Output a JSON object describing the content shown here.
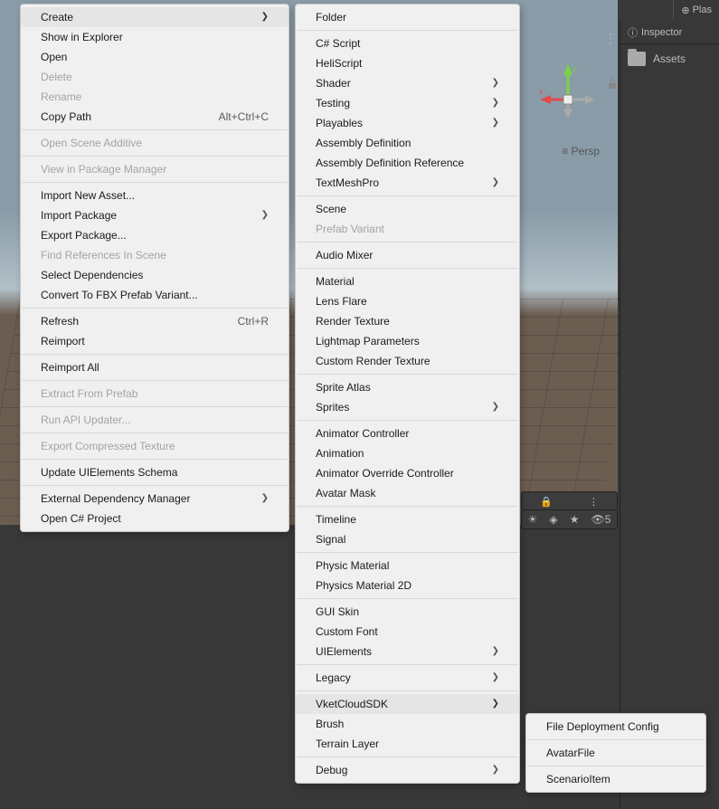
{
  "toolbar": {
    "plas": "Plas"
  },
  "scene": {
    "persp": "Persp",
    "visibility_count": "5"
  },
  "inspector": {
    "tab": "Inspector",
    "assets": "Assets"
  },
  "menu1": [
    {
      "label": "Create",
      "submenu": true,
      "hover": true
    },
    {
      "label": "Show in Explorer"
    },
    {
      "label": "Open"
    },
    {
      "label": "Delete",
      "disabled": true
    },
    {
      "label": "Rename",
      "disabled": true
    },
    {
      "label": "Copy Path",
      "shortcut": "Alt+Ctrl+C"
    },
    {
      "sep": true
    },
    {
      "label": "Open Scene Additive",
      "disabled": true
    },
    {
      "sep": true
    },
    {
      "label": "View in Package Manager",
      "disabled": true
    },
    {
      "sep": true
    },
    {
      "label": "Import New Asset..."
    },
    {
      "label": "Import Package",
      "submenu": true
    },
    {
      "label": "Export Package..."
    },
    {
      "label": "Find References In Scene",
      "disabled": true
    },
    {
      "label": "Select Dependencies"
    },
    {
      "label": "Convert To FBX Prefab Variant..."
    },
    {
      "sep": true
    },
    {
      "label": "Refresh",
      "shortcut": "Ctrl+R"
    },
    {
      "label": "Reimport"
    },
    {
      "sep": true
    },
    {
      "label": "Reimport All"
    },
    {
      "sep": true
    },
    {
      "label": "Extract From Prefab",
      "disabled": true
    },
    {
      "sep": true
    },
    {
      "label": "Run API Updater...",
      "disabled": true
    },
    {
      "sep": true
    },
    {
      "label": "Export Compressed Texture",
      "disabled": true
    },
    {
      "sep": true
    },
    {
      "label": "Update UIElements Schema"
    },
    {
      "sep": true
    },
    {
      "label": "External Dependency Manager",
      "submenu": true
    },
    {
      "label": "Open C# Project"
    }
  ],
  "menu2": [
    {
      "label": "Folder"
    },
    {
      "sep": true
    },
    {
      "label": "C# Script"
    },
    {
      "label": "HeliScript"
    },
    {
      "label": "Shader",
      "submenu": true
    },
    {
      "label": "Testing",
      "submenu": true
    },
    {
      "label": "Playables",
      "submenu": true
    },
    {
      "label": "Assembly Definition"
    },
    {
      "label": "Assembly Definition Reference"
    },
    {
      "label": "TextMeshPro",
      "submenu": true
    },
    {
      "sep": true
    },
    {
      "label": "Scene"
    },
    {
      "label": "Prefab Variant",
      "disabled": true
    },
    {
      "sep": true
    },
    {
      "label": "Audio Mixer"
    },
    {
      "sep": true
    },
    {
      "label": "Material"
    },
    {
      "label": "Lens Flare"
    },
    {
      "label": "Render Texture"
    },
    {
      "label": "Lightmap Parameters"
    },
    {
      "label": "Custom Render Texture"
    },
    {
      "sep": true
    },
    {
      "label": "Sprite Atlas"
    },
    {
      "label": "Sprites",
      "submenu": true
    },
    {
      "sep": true
    },
    {
      "label": "Animator Controller"
    },
    {
      "label": "Animation"
    },
    {
      "label": "Animator Override Controller"
    },
    {
      "label": "Avatar Mask"
    },
    {
      "sep": true
    },
    {
      "label": "Timeline"
    },
    {
      "label": "Signal"
    },
    {
      "sep": true
    },
    {
      "label": "Physic Material"
    },
    {
      "label": "Physics Material 2D"
    },
    {
      "sep": true
    },
    {
      "label": "GUI Skin"
    },
    {
      "label": "Custom Font"
    },
    {
      "label": "UIElements",
      "submenu": true
    },
    {
      "sep": true
    },
    {
      "label": "Legacy",
      "submenu": true
    },
    {
      "sep": true
    },
    {
      "label": "VketCloudSDK",
      "submenu": true,
      "hover": true
    },
    {
      "label": "Brush"
    },
    {
      "label": "Terrain Layer"
    },
    {
      "sep": true
    },
    {
      "label": "Debug",
      "submenu": true
    }
  ],
  "menu3": [
    {
      "label": "File Deployment Config"
    },
    {
      "sep": true
    },
    {
      "label": "AvatarFile"
    },
    {
      "sep": true
    },
    {
      "label": "ScenarioItem"
    }
  ]
}
